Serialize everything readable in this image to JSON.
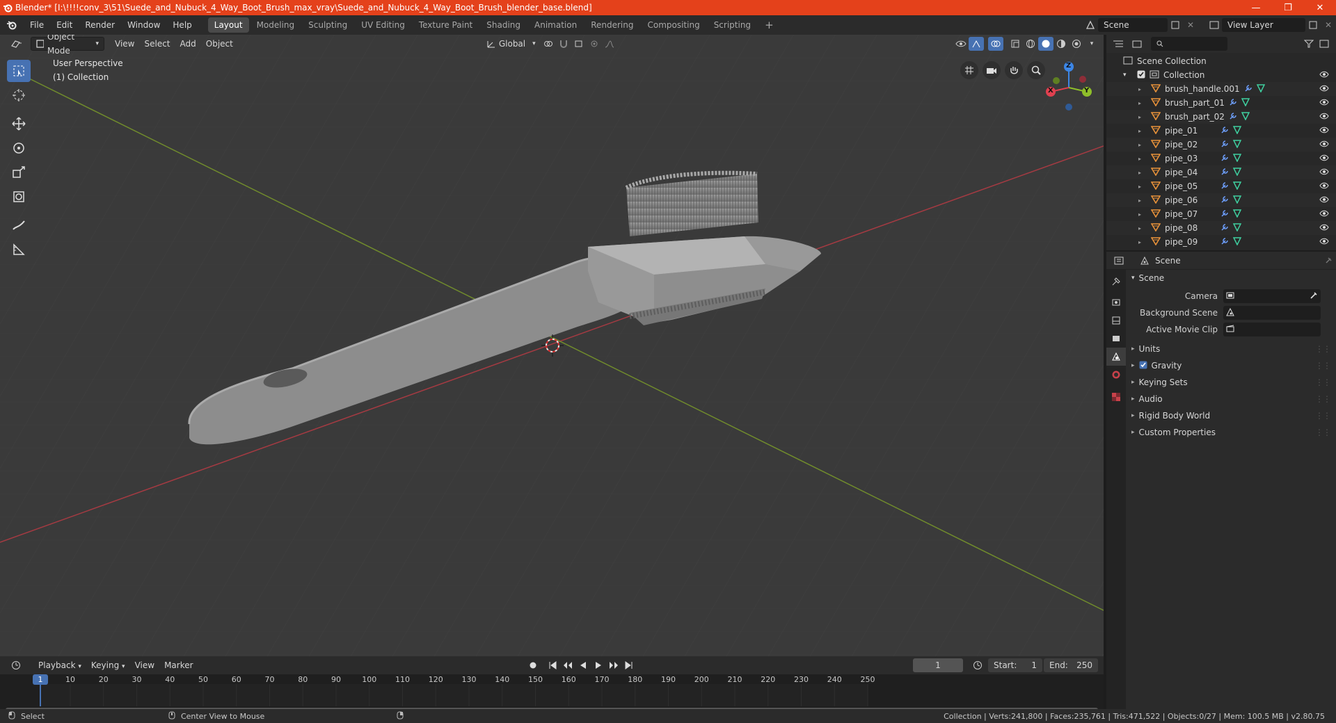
{
  "window": {
    "title": "Blender* [I:\\!!!!conv_3\\51\\Suede_and_Nubuck_4_Way_Boot_Brush_max_vray\\Suede_and_Nubuck_4_Way_Boot_Brush_blender_base.blend]",
    "minimize": "—",
    "maximize": "❐",
    "close": "✕"
  },
  "menu": [
    "File",
    "Edit",
    "Render",
    "Window",
    "Help"
  ],
  "workspaces": [
    {
      "label": "Layout",
      "active": true
    },
    {
      "label": "Modeling",
      "active": false
    },
    {
      "label": "Sculpting",
      "active": false
    },
    {
      "label": "UV Editing",
      "active": false
    },
    {
      "label": "Texture Paint",
      "active": false
    },
    {
      "label": "Shading",
      "active": false
    },
    {
      "label": "Animation",
      "active": false
    },
    {
      "label": "Rendering",
      "active": false
    },
    {
      "label": "Compositing",
      "active": false
    },
    {
      "label": "Scripting",
      "active": false
    }
  ],
  "add_workspace": "+",
  "scene_selector": "Scene",
  "view_layer": "View Layer",
  "viewport": {
    "mode": "Object Mode",
    "menus": [
      "View",
      "Select",
      "Add",
      "Object"
    ],
    "transform_orientation": "Global",
    "perspective_label": "User Perspective",
    "collection_label": "(1) Collection",
    "gizmo": {
      "x": "X",
      "y": "Y",
      "z": "Z"
    }
  },
  "tools": [
    "select-box",
    "cursor",
    "move",
    "rotate",
    "scale",
    "transform",
    "annotate",
    "measure"
  ],
  "outliner": {
    "search_placeholder": "",
    "scene_collection": "Scene Collection",
    "collection": "Collection",
    "objects": [
      "brush_handle.001",
      "brush_part_01",
      "brush_part_02",
      "pipe_01",
      "pipe_02",
      "pipe_03",
      "pipe_04",
      "pipe_05",
      "pipe_06",
      "pipe_07",
      "pipe_08",
      "pipe_09"
    ]
  },
  "properties": {
    "header": "Scene",
    "panel": "Scene",
    "fields": [
      {
        "label": "Camera",
        "value": ""
      },
      {
        "label": "Background Scene",
        "value": ""
      },
      {
        "label": "Active Movie Clip",
        "value": ""
      }
    ],
    "sections": [
      {
        "label": "Units",
        "checkbox": false
      },
      {
        "label": "Gravity",
        "checkbox": true
      },
      {
        "label": "Keying Sets",
        "checkbox": false
      },
      {
        "label": "Audio",
        "checkbox": false
      },
      {
        "label": "Rigid Body World",
        "checkbox": false
      },
      {
        "label": "Custom Properties",
        "checkbox": false
      }
    ]
  },
  "timeline": {
    "menus": [
      "Playback",
      "Keying",
      "View",
      "Marker"
    ],
    "current_frame": "1",
    "start_label": "Start:",
    "start": "1",
    "end_label": "End:",
    "end": "250",
    "ticks": [
      "1",
      "10",
      "20",
      "30",
      "40",
      "50",
      "60",
      "70",
      "80",
      "90",
      "100",
      "110",
      "120",
      "130",
      "140",
      "150",
      "160",
      "170",
      "180",
      "190",
      "200",
      "210",
      "220",
      "230",
      "240",
      "250"
    ]
  },
  "status": {
    "left_action": "Select",
    "middle_action": "Center View to Mouse",
    "stats": "Collection | Verts:241,800 | Faces:235,761 | Tris:471,522 | Objects:0/27 | Mem: 100.5 MB | v2.80.75"
  },
  "colors": {
    "accent": "#4772b3",
    "titlebar": "#e4411b",
    "object_icon": "#e8923a",
    "modifier_icon": "#6ea0ff",
    "mesh_icon": "#3fd0a0",
    "axis_x": "#e0404f",
    "axis_y": "#8fbf2a",
    "axis_z": "#3c86e6"
  }
}
